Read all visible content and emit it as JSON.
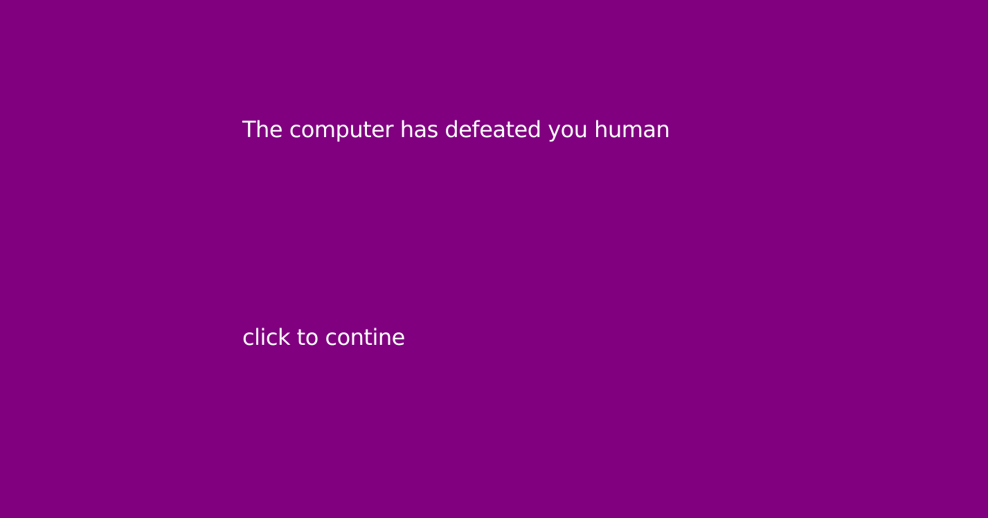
{
  "screen": {
    "background_color": "#800080",
    "text_color": "#ffffff",
    "defeat_message": "The computer has defeated you human",
    "continue_prompt": "click to contine"
  }
}
